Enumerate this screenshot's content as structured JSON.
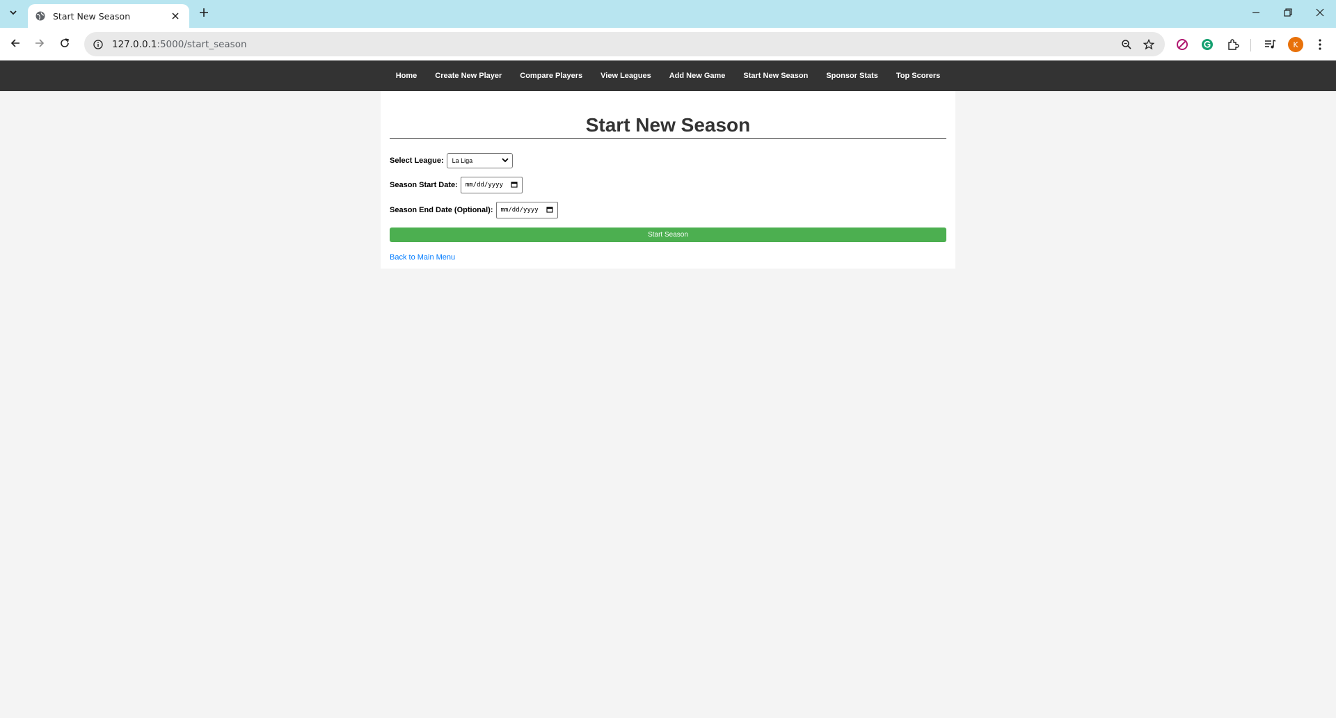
{
  "browser": {
    "tab_title": "Start New Season",
    "url_host": "127.0.0.1",
    "url_path": ":5000/start_season",
    "avatar_letter": "K",
    "avatar_color": "#e8710a"
  },
  "nav": {
    "items": [
      {
        "label": "Home"
      },
      {
        "label": "Create New Player"
      },
      {
        "label": "Compare Players"
      },
      {
        "label": "View Leagues"
      },
      {
        "label": "Add New Game"
      },
      {
        "label": "Start New Season"
      },
      {
        "label": "Sponsor Stats"
      },
      {
        "label": "Top Scorers"
      }
    ]
  },
  "page": {
    "title": "Start New Season",
    "league_label": "Select League:",
    "league_selected": "La Liga",
    "start_label": "Season Start Date:",
    "start_placeholder": "mm/dd/yyyy",
    "end_label": "Season End Date (Optional):",
    "end_placeholder": "mm/dd/yyyy",
    "submit_label": "Start Season",
    "back_link": "Back to Main Menu"
  },
  "colors": {
    "nav_bg": "#333333",
    "button_bg": "#4caf50",
    "link": "#007bff",
    "tabbar_bg": "#b8e5f0"
  }
}
